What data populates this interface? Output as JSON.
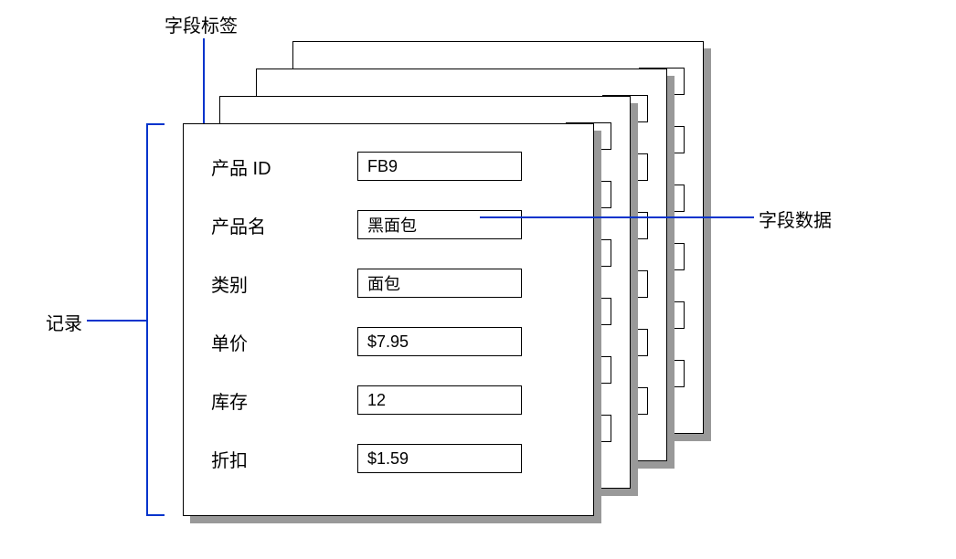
{
  "annotations": {
    "field_label": "字段标签",
    "field_data": "字段数据",
    "record": "记录"
  },
  "record": {
    "fields": [
      {
        "label": "产品 ID",
        "value": "FB9"
      },
      {
        "label": "产品名",
        "value": "黑面包"
      },
      {
        "label": "类别",
        "value": "面包"
      },
      {
        "label": "单价",
        "value": "$7.95"
      },
      {
        "label": "库存",
        "value": "12"
      },
      {
        "label": "折扣",
        "value": "$1.59"
      }
    ]
  }
}
